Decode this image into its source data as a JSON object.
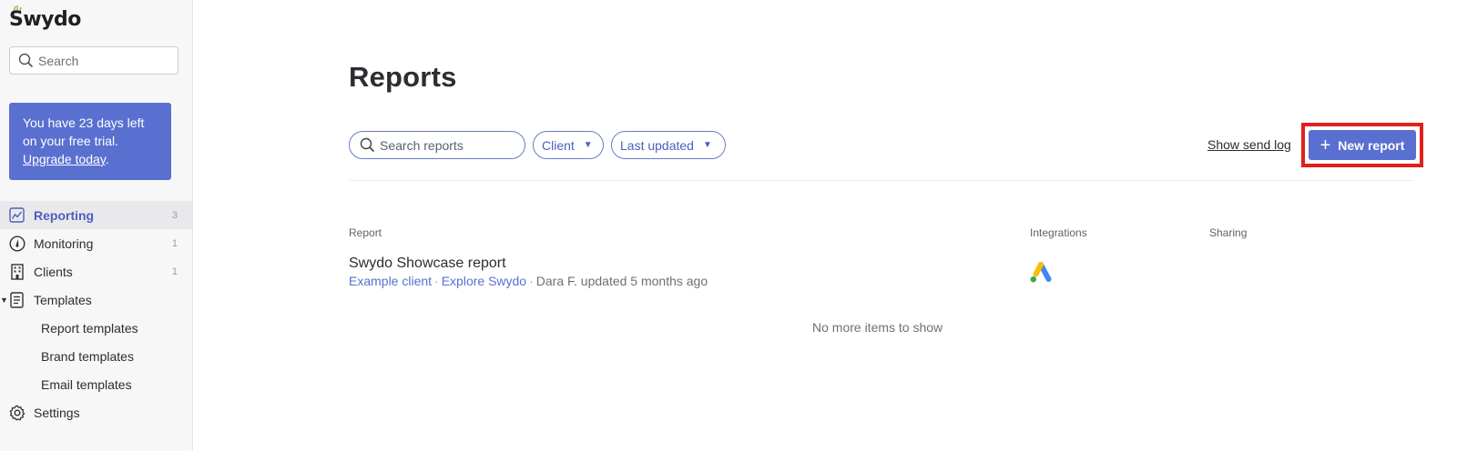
{
  "app": {
    "logo_text": "Swydo"
  },
  "sidebar": {
    "search_placeholder": "Search",
    "trial": {
      "line1": "You have 23 days left",
      "line2": "on your free trial.",
      "upgrade_link": "Upgrade today",
      "period": "."
    },
    "nav": [
      {
        "label": "Reporting",
        "count": "3",
        "icon": "reporting-icon",
        "active": true
      },
      {
        "label": "Monitoring",
        "count": "1",
        "icon": "monitoring-icon"
      },
      {
        "label": "Clients",
        "count": "1",
        "icon": "clients-icon"
      },
      {
        "label": "Templates",
        "icon": "templates-icon",
        "expanded": true,
        "children": [
          {
            "label": "Report templates"
          },
          {
            "label": "Brand templates"
          },
          {
            "label": "Email templates"
          }
        ]
      },
      {
        "label": "Settings",
        "icon": "gear-icon"
      }
    ]
  },
  "main": {
    "title": "Reports",
    "toolbar": {
      "search_placeholder": "Search reports",
      "client_filter": "Client",
      "sort_filter": "Last updated",
      "send_log": "Show send log",
      "new_report": "New report"
    },
    "table": {
      "columns": [
        "Report",
        "Integrations",
        "Sharing"
      ],
      "rows": [
        {
          "title": "Swydo Showcase report",
          "client": "Example client",
          "dot1": "·",
          "project": "Explore Swydo",
          "dot2": "·",
          "updated": "Dara F. updated 5 months ago",
          "integration_icon": "google-ads-icon"
        }
      ],
      "end_message": "No more items to show"
    }
  },
  "colors": {
    "accent": "#5a70d0",
    "highlight_frame": "#e0201b",
    "sidebar_bg": "#f7f7f8"
  }
}
